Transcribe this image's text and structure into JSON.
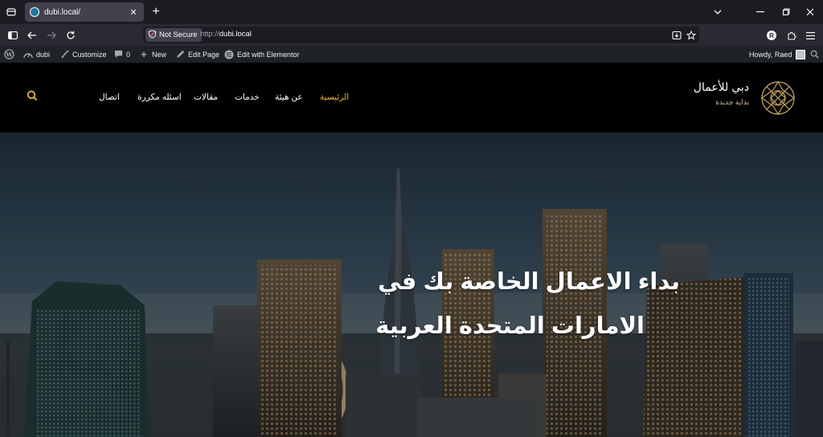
{
  "browser": {
    "tab_title": "dubi.local/",
    "security_label": "Not Secure",
    "url_protocol": "http://",
    "url_host": "dubi.local",
    "profile_initial": "R"
  },
  "adminbar": {
    "site_name": "dubi",
    "customize": "Customize",
    "comments_count": "0",
    "new": "New",
    "edit_page": "Edit Page",
    "edit_elementor": "Edit with Elementor",
    "howdy": "Howdy, Raed"
  },
  "site": {
    "logo_title": "دبي للأعمال",
    "logo_subtitle": "بداية جديدة",
    "menu": [
      {
        "label": "الرئيسية",
        "active": true
      },
      {
        "label": "عن هيئة",
        "active": false
      },
      {
        "label": "خدمات",
        "active": false
      },
      {
        "label": "مقالات",
        "active": false
      },
      {
        "label": "اسئله مكررة",
        "active": false
      },
      {
        "label": "اتصال",
        "active": false
      }
    ],
    "accent_color": "#e8b63a"
  },
  "hero": {
    "line1": "بداء الاعمال الخاصة بك في",
    "line2": "الامارات المتحدة العربية"
  }
}
